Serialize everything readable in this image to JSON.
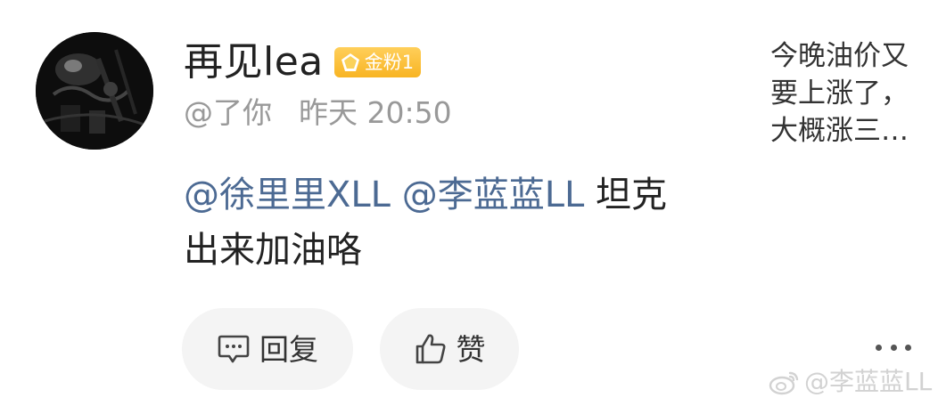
{
  "comment": {
    "username": "再见lea",
    "badge_label": "金粉1",
    "handle": "@了你",
    "timestamp": "昨天 20:50",
    "mention_1": "@徐里里XLL",
    "mention_2": "@李蓝蓝LL",
    "text_line_1_tail": "坦克",
    "text_line_2": "出来加油咯"
  },
  "actions": {
    "reply_label": "回复",
    "like_label": "赞",
    "reply_icon": "comment-bubble-icon",
    "like_icon": "thumbs-up-icon",
    "more_icon": "more-dots-icon"
  },
  "preview": {
    "text": "今晚油价又要上涨了，大概涨三…"
  },
  "watermark": {
    "text": "@李蓝蓝LL",
    "icon": "weibo-logo-icon"
  },
  "colors": {
    "mention": "#4c6a93",
    "badge": "#f8b423",
    "meta": "#999999",
    "button_bg": "#f4f4f4"
  }
}
